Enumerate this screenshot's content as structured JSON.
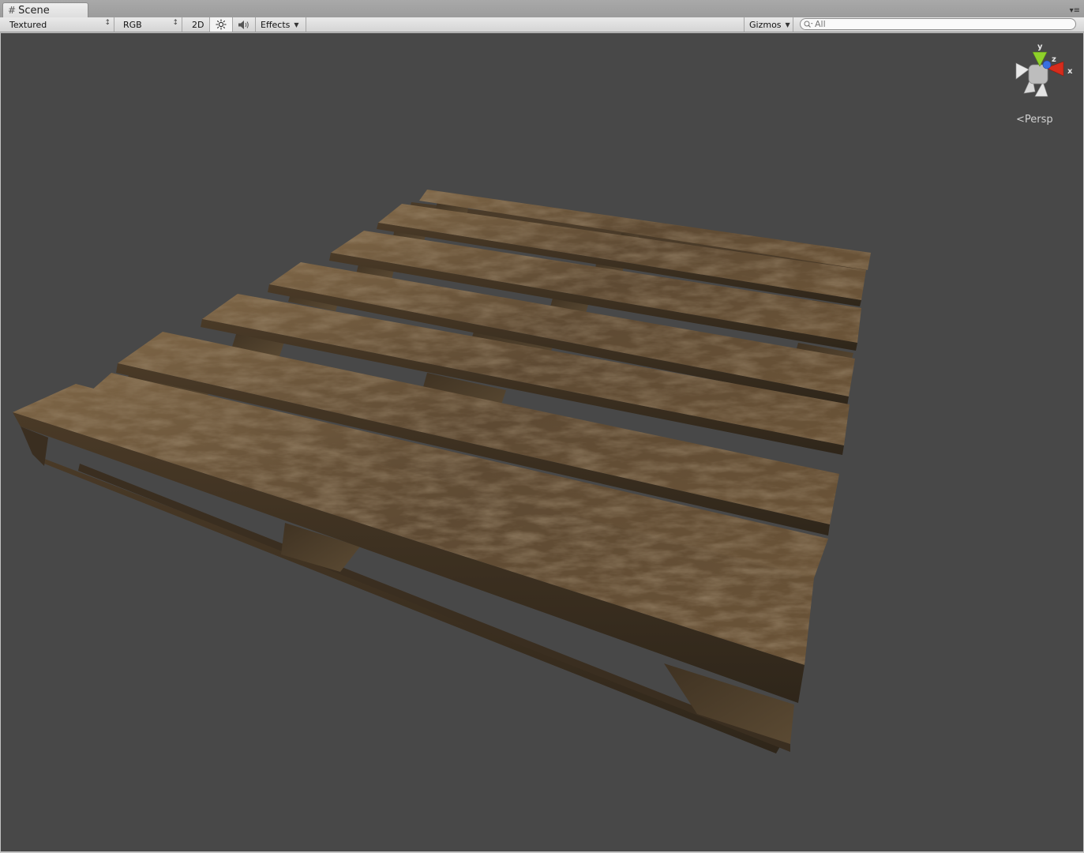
{
  "window": {
    "tab_title": "Scene",
    "tab_icon": "scene-grid-icon"
  },
  "toolbar": {
    "draw_mode": "Textured",
    "render_mode": "RGB",
    "mode_2d": "2D",
    "lighting_icon": "sun-icon",
    "audio_icon": "speaker-icon",
    "effects_label": "Effects",
    "gizmos_label": "Gizmos",
    "search_placeholder": "All"
  },
  "scene_gizmo": {
    "axis_y": "y",
    "axis_z": "z",
    "axis_x": "x",
    "projection_label": "Persp",
    "colors": {
      "x": "#d62c1c",
      "y": "#8fd12a",
      "z": "#3a6fe0"
    }
  },
  "viewport": {
    "background_color": "#484848",
    "object": "wooden-pallet"
  }
}
